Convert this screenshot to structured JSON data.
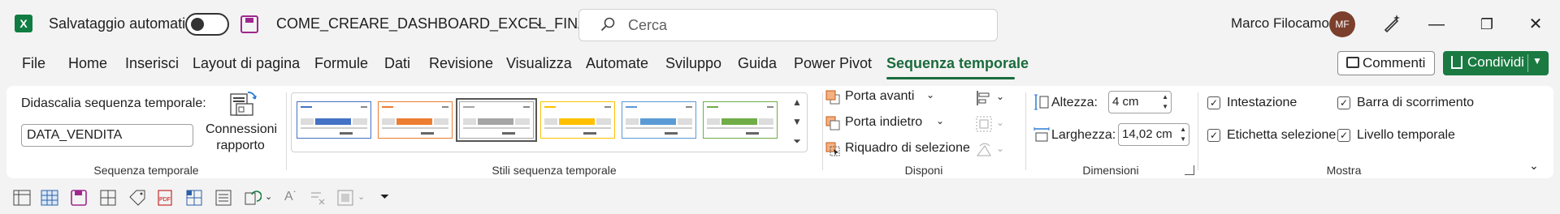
{
  "titlebar": {
    "app_icon": "X",
    "autosave_label": "Salvataggio automatico",
    "autosave_state": "off",
    "filename": "COME_CREARE_DASHBOARD_EXCEL_FINAL.x...",
    "search_placeholder": "Cerca",
    "user_name": "Marco Filocamo",
    "user_initials": "MF",
    "minimize": "—",
    "restore": "❐",
    "close": "✕"
  },
  "tabs": [
    {
      "label": "File"
    },
    {
      "label": "Home"
    },
    {
      "label": "Inserisci"
    },
    {
      "label": "Layout di pagina"
    },
    {
      "label": "Formule"
    },
    {
      "label": "Dati"
    },
    {
      "label": "Revisione"
    },
    {
      "label": "Visualizza"
    },
    {
      "label": "Automate"
    },
    {
      "label": "Sviluppo"
    },
    {
      "label": "Guida"
    },
    {
      "label": "Power Pivot"
    },
    {
      "label": "Sequenza temporale",
      "active": true
    }
  ],
  "actions": {
    "comments": "Commenti",
    "share": "Condividi"
  },
  "ribbon": {
    "sequenza": {
      "caption_label": "Didascalia sequenza temporale:",
      "caption_value": "DATA_VENDITA",
      "connections_line1": "Connessioni",
      "connections_line2": "rapporto",
      "group_label": "Sequenza temporale"
    },
    "stili": {
      "group_label": "Stili sequenza temporale",
      "thumbs": [
        {
          "color": "#4472c4"
        },
        {
          "color": "#ed7d31"
        },
        {
          "color": "#a5a5a5",
          "selected": true
        },
        {
          "color": "#ffc000"
        },
        {
          "color": "#5b9bd5"
        },
        {
          "color": "#70ad47"
        }
      ]
    },
    "disponi": {
      "group_label": "Disponi",
      "bring_forward": "Porta avanti",
      "send_backward": "Porta indietro",
      "selection_pane": "Riquadro di selezione"
    },
    "dimensioni": {
      "group_label": "Dimensioni",
      "height_label": "Altezza:",
      "height_value": "4 cm",
      "width_label": "Larghezza:",
      "width_value": "14,02 cm"
    },
    "mostra": {
      "group_label": "Mostra",
      "header": "Intestazione",
      "scrollbar": "Barra di scorrimento",
      "selection_label": "Etichetta selezione",
      "time_level": "Livello temporale"
    }
  }
}
